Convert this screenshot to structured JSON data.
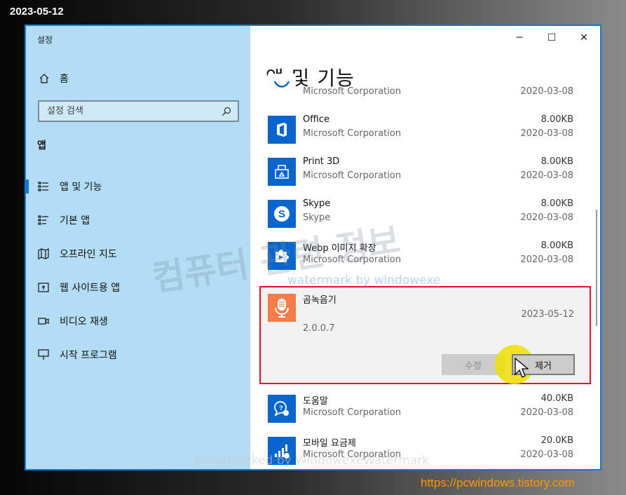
{
  "overlay": {
    "date_stamp": "2023-05-12",
    "site_url": "https://pcwindows.tistory.com",
    "watermark_main": "컴퓨터 관련 정보",
    "watermark_sub": "watermark by windowexe",
    "watermark_bottom": "Watermarked by WindowexeWatermark"
  },
  "window": {
    "title": "설정",
    "controls": {
      "minimize": "─",
      "maximize": "☐",
      "close": "✕"
    }
  },
  "sidebar": {
    "home_label": "홈",
    "search_placeholder": "설정 검색",
    "section_header": "앱",
    "items": [
      {
        "label": "앱 및 기능",
        "icon": "apps-features-icon",
        "active": true
      },
      {
        "label": "기본 앱",
        "icon": "default-apps-icon",
        "active": false
      },
      {
        "label": "오프라인 지도",
        "icon": "offline-maps-icon",
        "active": false
      },
      {
        "label": "웹 사이트용 앱",
        "icon": "apps-for-websites-icon",
        "active": false
      },
      {
        "label": "비디오 재생",
        "icon": "video-playback-icon",
        "active": false
      },
      {
        "label": "시작 프로그램",
        "icon": "startup-icon",
        "active": false
      }
    ]
  },
  "main": {
    "page_title": "앱 및 기능",
    "apps": [
      {
        "name": "",
        "publisher": "Microsoft Corporation",
        "size": "",
        "date": "2020-03-08",
        "icon": "feedback-hub-icon"
      },
      {
        "name": "Office",
        "publisher": "Microsoft Corporation",
        "size": "8.00KB",
        "date": "2020-03-08",
        "icon": "office-icon"
      },
      {
        "name": "Print 3D",
        "publisher": "Microsoft Corporation",
        "size": "8.00KB",
        "date": "2020-03-08",
        "icon": "print-3d-icon"
      },
      {
        "name": "Skype",
        "publisher": "Skype",
        "size": "8.00KB",
        "date": "2020-03-08",
        "icon": "skype-icon"
      },
      {
        "name": "Webp 이미지 확장",
        "publisher": "Microsoft Corporation",
        "size": "8.00KB",
        "date": "2020-03-08",
        "icon": "webp-extension-icon"
      }
    ],
    "selected_app": {
      "name": "곰녹음기",
      "date": "2023-05-12",
      "version": "2.0.0.7",
      "modify_label": "수정",
      "remove_label": "제거",
      "icon": "microphone-icon",
      "icon_color": "#f47d4a"
    },
    "apps_after": [
      {
        "name": "도움말",
        "publisher": "Microsoft Corporation",
        "size": "40.0KB",
        "date": "2020-03-08",
        "icon": "get-help-icon"
      },
      {
        "name": "모바일 요금제",
        "publisher": "Microsoft Corporation",
        "size": "20.0KB",
        "date": "2020-03-08",
        "icon": "mobile-plans-icon"
      }
    ]
  },
  "colors": {
    "sidebar_bg": "#b3ddf4",
    "accent": "#0078d7",
    "selection_border": "#e81123",
    "app_tile": "#0a66cc"
  }
}
